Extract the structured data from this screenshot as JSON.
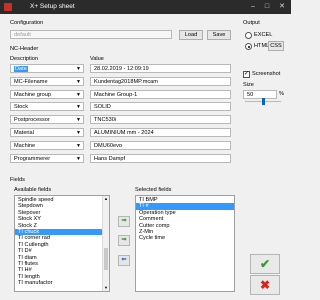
{
  "window": {
    "title": "X+ Setup sheet"
  },
  "configuration": {
    "heading": "Configuration",
    "value": "default",
    "load_label": "Load",
    "save_label": "Save"
  },
  "output": {
    "heading": "Output",
    "excel_label": "EXCEL",
    "html_label": "HTML",
    "css_label": "CSS",
    "selected": "HTML",
    "screenshot_label": "Screenshot",
    "screenshot_checked": true,
    "size_label": "Size",
    "size_value": "50",
    "size_unit": "%",
    "size_slider_fraction": 0.5
  },
  "nc_header": {
    "heading": "NC-Header",
    "col_description": "Description",
    "col_value": "Value",
    "rows": [
      {
        "description": "Date",
        "value": "28.02.2019 - 12:09:19",
        "selected": true
      },
      {
        "description": "MC-Filename",
        "value": "Kundentag2018MP.mcam"
      },
      {
        "description": "Machine group",
        "value": "Machine Group-1"
      },
      {
        "description": "Stock",
        "value": "SOLID"
      },
      {
        "description": "Postprocessor",
        "value": "TNC530i"
      },
      {
        "description": "Material",
        "value": "ALUMINIUM mm - 2024"
      },
      {
        "description": "Machine",
        "value": "DMU60evo"
      },
      {
        "description": "Programmerer",
        "value": "Hans Dampf"
      }
    ]
  },
  "fields": {
    "heading": "Fields",
    "available_label": "Available fields",
    "selected_label": "Selected fields",
    "available": [
      {
        "label": "Spindle speed"
      },
      {
        "label": "Stepdown"
      },
      {
        "label": "Stepover"
      },
      {
        "label": "Stock XY"
      },
      {
        "label": "Stock Z"
      },
      {
        "label": "TI chuck",
        "selected": true
      },
      {
        "label": "TI corner rad"
      },
      {
        "label": "TI Cutlength"
      },
      {
        "label": "TI D#"
      },
      {
        "label": "TI diam"
      },
      {
        "label": "TI flutes"
      },
      {
        "label": "TI H#"
      },
      {
        "label": "TI length"
      },
      {
        "label": "TI manufactor"
      }
    ],
    "selected": [
      {
        "label": "TI BMP"
      },
      {
        "label": "TI #",
        "selected": true
      },
      {
        "label": "Operation type"
      },
      {
        "label": "Comment"
      },
      {
        "label": "Cutter comp"
      },
      {
        "label": "Z-Min"
      },
      {
        "label": "Cycle time"
      }
    ]
  },
  "actions": {
    "ok_icon": "check-icon",
    "cancel_icon": "cross-icon",
    "ok_color": "#2e9e2e",
    "cancel_color": "#d9261c"
  }
}
